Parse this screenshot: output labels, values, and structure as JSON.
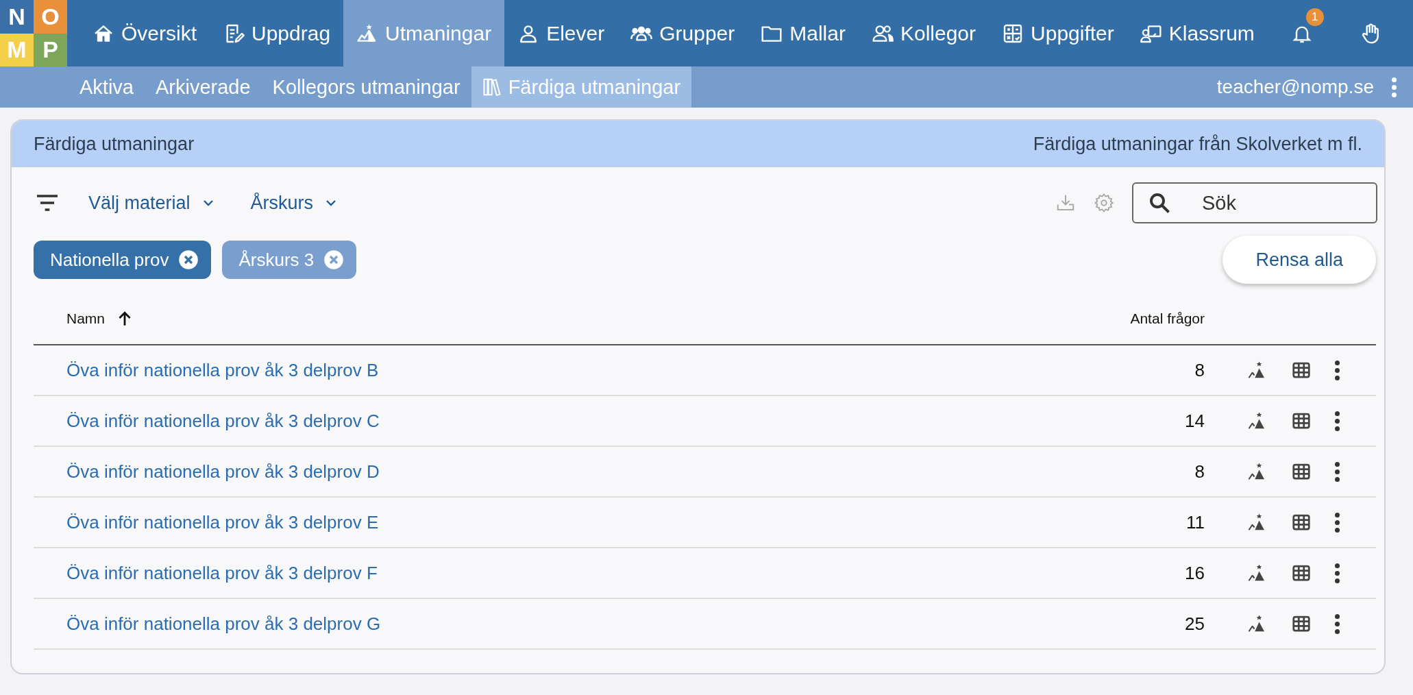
{
  "logo": [
    {
      "letter": "N",
      "color": "#3a6fa8"
    },
    {
      "letter": "O",
      "color": "#e8903a"
    },
    {
      "letter": "M",
      "color": "#f4cf4a"
    },
    {
      "letter": "P",
      "color": "#7da65a"
    }
  ],
  "nav": {
    "items": [
      {
        "label": "Översikt",
        "selected": false
      },
      {
        "label": "Uppdrag",
        "selected": false
      },
      {
        "label": "Utmaningar",
        "selected": true
      },
      {
        "label": "Elever",
        "selected": false
      },
      {
        "label": "Grupper",
        "selected": false
      },
      {
        "label": "Mallar",
        "selected": false
      },
      {
        "label": "Kollegor",
        "selected": false
      },
      {
        "label": "Uppgifter",
        "selected": false
      },
      {
        "label": "Klassrum",
        "selected": false
      }
    ],
    "notifications": "1"
  },
  "subnav": {
    "items": [
      {
        "label": "Aktiva",
        "selected": false
      },
      {
        "label": "Arkiverade",
        "selected": false
      },
      {
        "label": "Kollegors utmaningar",
        "selected": false
      },
      {
        "label": "Färdiga utmaningar",
        "selected": true
      }
    ],
    "user": "teacher@nomp.se"
  },
  "card": {
    "title": "Färdiga utmaningar",
    "subtitle": "Färdiga utmaningar från Skolverket m fl.",
    "filters": [
      "Välj material",
      "Årskurs"
    ],
    "search": {
      "placeholder": "Sök"
    },
    "chips": [
      {
        "label": "Nationella prov",
        "color": "#3570a8"
      },
      {
        "label": "Årskurs 3",
        "color": "#7a9fcf"
      }
    ],
    "clear_button": "Rensa alla",
    "table": {
      "columns": [
        {
          "label": "Namn"
        },
        {
          "label": "Antal frågor"
        }
      ],
      "rows": [
        {
          "name": "Öva inför nationella prov åk 3 delprov B",
          "questions": "8"
        },
        {
          "name": "Öva inför nationella prov åk 3 delprov C",
          "questions": "14"
        },
        {
          "name": "Öva inför nationella prov åk 3 delprov D",
          "questions": "8"
        },
        {
          "name": "Öva inför nationella prov åk 3 delprov E",
          "questions": "11"
        },
        {
          "name": "Öva inför nationella prov åk 3 delprov F",
          "questions": "16"
        },
        {
          "name": "Öva inför nationella prov åk 3 delprov G",
          "questions": "25"
        }
      ]
    }
  }
}
